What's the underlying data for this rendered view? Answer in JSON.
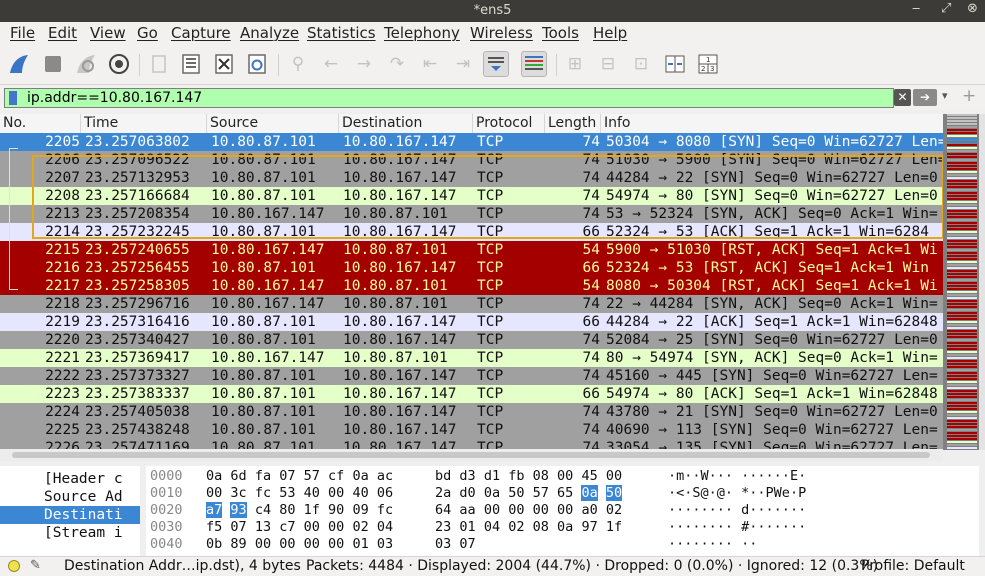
{
  "window": {
    "title": "*ens5"
  },
  "menu": [
    "File",
    "Edit",
    "View",
    "Go",
    "Capture",
    "Analyze",
    "Statistics",
    "Telephony",
    "Wireless",
    "Tools",
    "Help"
  ],
  "filter": {
    "value": "ip.addr==10.80.167.147"
  },
  "columns": [
    "No.",
    "Time",
    "Source",
    "Destination",
    "Protocol",
    "Length",
    "Info"
  ],
  "colors": {
    "selected": "#3b87d4",
    "syn_gray": "#a0a0a0",
    "ack_lavender": "#e7e6ff",
    "green": "#e4ffc7",
    "rst_red": "#a40000",
    "filter_green": "#afffaf",
    "related_box": "#e3a61d"
  },
  "packets": [
    {
      "no": "2205",
      "time": "23.257063802",
      "src": "10.80.87.101",
      "dst": "10.80.167.147",
      "proto": "TCP",
      "len": "74",
      "info": "50304 → 8080 [SYN] Seq=0 Win=62727 Len=0",
      "style": "sel"
    },
    {
      "no": "2206",
      "time": "23.257096522",
      "src": "10.80.87.101",
      "dst": "10.80.167.147",
      "proto": "TCP",
      "len": "74",
      "info": "51030 → 5900 [SYN] Seq=0 Win=62727 Len=0",
      "style": "gray"
    },
    {
      "no": "2207",
      "time": "23.257132953",
      "src": "10.80.87.101",
      "dst": "10.80.167.147",
      "proto": "TCP",
      "len": "74",
      "info": "44284 → 22 [SYN] Seq=0 Win=62727 Len=0",
      "style": "gray"
    },
    {
      "no": "2208",
      "time": "23.257166684",
      "src": "10.80.87.101",
      "dst": "10.80.167.147",
      "proto": "TCP",
      "len": "74",
      "info": "54974 → 80 [SYN] Seq=0 Win=62727 Len=0",
      "style": "green"
    },
    {
      "no": "2213",
      "time": "23.257208354",
      "src": "10.80.167.147",
      "dst": "10.80.87.101",
      "proto": "TCP",
      "len": "74",
      "info": "53 → 52324 [SYN, ACK] Seq=0 Ack=1 Win=",
      "style": "gray"
    },
    {
      "no": "2214",
      "time": "23.257232245",
      "src": "10.80.87.101",
      "dst": "10.80.167.147",
      "proto": "TCP",
      "len": "66",
      "info": "52324 → 53 [ACK] Seq=1 Ack=1 Win=6284",
      "style": "lav"
    },
    {
      "no": "2215",
      "time": "23.257240655",
      "src": "10.80.167.147",
      "dst": "10.80.87.101",
      "proto": "TCP",
      "len": "54",
      "info": "5900 → 51030 [RST, ACK] Seq=1 Ack=1 Wi",
      "style": "red"
    },
    {
      "no": "2216",
      "time": "23.257256455",
      "src": "10.80.87.101",
      "dst": "10.80.167.147",
      "proto": "TCP",
      "len": "66",
      "info": "52324 → 53 [RST, ACK] Seq=1 Ack=1 Win",
      "style": "red"
    },
    {
      "no": "2217",
      "time": "23.257258305",
      "src": "10.80.167.147",
      "dst": "10.80.87.101",
      "proto": "TCP",
      "len": "54",
      "info": "8080 → 50304 [RST, ACK] Seq=1 Ack=1 Wi",
      "style": "red"
    },
    {
      "no": "2218",
      "time": "23.257296716",
      "src": "10.80.167.147",
      "dst": "10.80.87.101",
      "proto": "TCP",
      "len": "74",
      "info": "22 → 44284 [SYN, ACK] Seq=0 Ack=1 Win=",
      "style": "gray"
    },
    {
      "no": "2219",
      "time": "23.257316416",
      "src": "10.80.87.101",
      "dst": "10.80.167.147",
      "proto": "TCP",
      "len": "66",
      "info": "44284 → 22 [ACK] Seq=1 Ack=1 Win=62848",
      "style": "lav"
    },
    {
      "no": "2220",
      "time": "23.257340427",
      "src": "10.80.87.101",
      "dst": "10.80.167.147",
      "proto": "TCP",
      "len": "74",
      "info": "52084 → 25 [SYN] Seq=0 Win=62727 Len=0",
      "style": "gray"
    },
    {
      "no": "2221",
      "time": "23.257369417",
      "src": "10.80.167.147",
      "dst": "10.80.87.101",
      "proto": "TCP",
      "len": "74",
      "info": "80 → 54974 [SYN, ACK] Seq=0 Ack=1 Win=",
      "style": "green"
    },
    {
      "no": "2222",
      "time": "23.257373327",
      "src": "10.80.87.101",
      "dst": "10.80.167.147",
      "proto": "TCP",
      "len": "74",
      "info": "45160 → 445 [SYN] Seq=0 Win=62727 Len=",
      "style": "gray"
    },
    {
      "no": "2223",
      "time": "23.257383337",
      "src": "10.80.87.101",
      "dst": "10.80.167.147",
      "proto": "TCP",
      "len": "66",
      "info": "54974 → 80 [ACK] Seq=1 Ack=1 Win=62848",
      "style": "green"
    },
    {
      "no": "2224",
      "time": "23.257405038",
      "src": "10.80.87.101",
      "dst": "10.80.167.147",
      "proto": "TCP",
      "len": "74",
      "info": "43780 → 21 [SYN] Seq=0 Win=62727 Len=0",
      "style": "gray"
    },
    {
      "no": "2225",
      "time": "23.257438248",
      "src": "10.80.87.101",
      "dst": "10.80.167.147",
      "proto": "TCP",
      "len": "74",
      "info": "40690 → 113 [SYN] Seq=0 Win=62727 Len=",
      "style": "gray"
    },
    {
      "no": "2226",
      "time": "23.257471169",
      "src": "10.80.87.101",
      "dst": "10.80.167.147",
      "proto": "TCP",
      "len": "74",
      "info": "33054 → 135 [SYN] Seq=0 Win=62727 Len=",
      "style": "gray"
    }
  ],
  "details": [
    {
      "label": "[Header c",
      "selected": false
    },
    {
      "label": "Source Ad",
      "selected": false
    },
    {
      "label": "Destinati",
      "selected": true
    },
    {
      "label": "[Stream i",
      "selected": false
    }
  ],
  "bytes": [
    {
      "offset": "0000",
      "hex1": [
        "0a",
        "6d",
        "fa",
        "07",
        "57",
        "cf",
        "0a",
        "ac"
      ],
      "hex2": [
        "bd",
        "d3",
        "d1",
        "fb",
        "08",
        "00",
        "45",
        "00"
      ],
      "ascii1": "·m··W···",
      "ascii2": "······E·",
      "hl": []
    },
    {
      "offset": "0010",
      "hex1": [
        "00",
        "3c",
        "fc",
        "53",
        "40",
        "00",
        "40",
        "06"
      ],
      "hex2": [
        "2a",
        "d0",
        "0a",
        "50",
        "57",
        "65",
        "0a",
        "50"
      ],
      "ascii1": "·<·S@·@·",
      "ascii2": "*··PWe·P",
      "hl": [
        14,
        15
      ]
    },
    {
      "offset": "0020",
      "hex1": [
        "a7",
        "93",
        "c4",
        "80",
        "1f",
        "90",
        "09",
        "fc"
      ],
      "hex2": [
        "64",
        "aa",
        "00",
        "00",
        "00",
        "00",
        "a0",
        "02"
      ],
      "ascii1": "········",
      "ascii2": "d·······",
      "hl": [
        0,
        1
      ]
    },
    {
      "offset": "0030",
      "hex1": [
        "f5",
        "07",
        "13",
        "c7",
        "00",
        "00",
        "02",
        "04"
      ],
      "hex2": [
        "23",
        "01",
        "04",
        "02",
        "08",
        "0a",
        "97",
        "1f"
      ],
      "ascii1": "········",
      "ascii2": "#·······",
      "hl": []
    },
    {
      "offset": "0040",
      "hex1": [
        "0b",
        "89",
        "00",
        "00",
        "00",
        "00",
        "01",
        "03"
      ],
      "hex2": [
        "03",
        "07"
      ],
      "ascii1": "········",
      "ascii2": "··",
      "hl": []
    }
  ],
  "status": {
    "field": "Destination Addr…ip.dst), 4 bytes",
    "packets": "Packets: 4484 · Displayed: 2004 (44.7%) · Dropped: 0 (0.0%) · Ignored: 12 (0.3%)",
    "profile": "Profile: Default"
  }
}
